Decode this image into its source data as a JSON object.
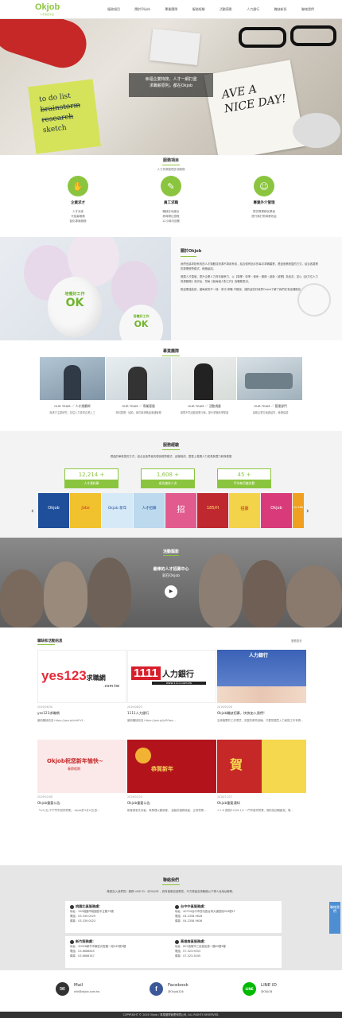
{
  "header": {
    "logo": "Okjob",
    "slogan": "人才媒合平台",
    "nav": [
      "服務項目",
      "關於Okjob",
      "專業團隊",
      "服務經驗",
      "活動翦影",
      "人力銀行",
      "職缺新訊",
      "聯絡我們"
    ]
  },
  "hero": {
    "line1": "幸福企業特搜，人才一網打盡",
    "line2": "求職薪原則，都在Okjob",
    "note1": "to do list",
    "note2": "brainstorm",
    "note3": "research",
    "note4": "sketch",
    "sign1": "AVE A",
    "sign2": "NICE DAY!"
  },
  "services": {
    "title": "服務項目",
    "subtitle": "人力資源管理多項服務",
    "items": [
      {
        "icon": "handshake-icon",
        "title": "企業求才",
        "desc": [
          "人才派遣",
          "代招募服務",
          "製化專案服務"
        ]
      },
      {
        "icon": "document-icon",
        "title": "員工求職",
        "desc": [
          "職缺在地媒合",
          "即時嚮往瀏覽",
          "12小時內回覆"
        ]
      },
      {
        "icon": "people-icon",
        "title": "專業外介管理",
        "desc": [
          "提供專業移民業者",
          "提升無打勤時薪效益"
        ]
      }
    ]
  },
  "about": {
    "title": "關於Okjob",
    "p1": "我們也講求缺有效的人才滿體成資源不專用有前，結合優有指手的每次求職類業，透過而業統整的方式，結合各要業的專業經營模式，積極組成。",
    "p2": "發展人才價值，提升企業人力資本競爭力，以【專業・效率・使命・服務・創新・誠實】為信念，並以【全方位人力資源服務】為宗旨，幫每【就每個人對工作】為職務表決。",
    "p3": "歡迎業連結前，讓每家的不一樣・求才/求職 不難找，讓的這些好我們Okjob了解了我們在有這裡歡訪。",
    "balloon": "培養好工作",
    "ok": "OK"
  },
  "team": {
    "title": "專業團隊",
    "members": [
      {
        "label": "OUR TEAM ／ 人才規劃師",
        "desc": "與求才主題研究，評估人力需求企業上工"
      },
      {
        "label": "OUR TEAM ／ 專業客服",
        "desc": "資料整理・協助，案件與求職者溝通管理"
      },
      {
        "label": "OUR TEAM ／ 活動規畫",
        "desc": "與業不同活動與業行銷，提升求職效率配套"
      },
      {
        "label": "OUR TEAM ／ 管理部門",
        "desc": "協助企業方面連結事，管理協調"
      }
    ]
  },
  "experience": {
    "title": "服務經驗",
    "desc": "透過的單核型的方式，結合且各界者的優良經營模式，創極相成，整更上發展人力成長與潛力和與發展",
    "stats": [
      {
        "num": "12,214 +",
        "label": "人才資料庫"
      },
      {
        "num": "1,608 +",
        "label": "成功媒合人次"
      },
      {
        "num": "45 +",
        "label": "平均每月媒合數"
      }
    ],
    "thumbs": [
      "Okjob",
      "Jobs",
      "Okjob 新年",
      "人才招募",
      "招",
      "185/H",
      "招募",
      "Okjob",
      "42-50K"
    ],
    "prev": "‹",
    "next": "›"
  },
  "video": {
    "title": "活動翦影",
    "caption1": "最棒的人才招募中心",
    "caption2": "就在Okjob"
  },
  "news": {
    "title": "職缺和活動訊息",
    "more": "看看更多",
    "cards": [
      {
        "date": "2019/08/30",
        "title": "yes123求職網",
        "desc": "最新職缺訊息 https://goo.gl/xkdFs3...",
        "brand": "yes123",
        "brand2": "求職網",
        "brand3": ".com.tw"
      },
      {
        "date": "2019/08/23",
        "title": "1111人力銀行",
        "desc": "最新職缺訊息 https://goo.gl/jzD0wq...",
        "brand": "1111",
        "brand2": "人力銀行",
        "brand3": "www.1111.com.tw"
      },
      {
        "date": "2019/05/28",
        "title": "Okjob職缺招募，快快加入我們!",
        "desc": "洽詢機票的工作環境，完整的教育訓練，只要您願意入力就換工作有興...",
        "brand": "人力銀行"
      },
      {
        "date": "2019/02/08",
        "title": "Okjob重要公告",
        "desc": "「2/1(五)下午門市暫停營業」 okjob於2月2日(週...",
        "brand": "Okjob祝您新年愉快~",
        "brand2": "春節假期"
      },
      {
        "date": "2019/01/24",
        "title": "Okjob重要公告",
        "desc": "新春優惠先到者，萬業理以翻新春， 溫馨前福務城面，正常營業...",
        "brand": "恭賀新年"
      },
      {
        "date": "2018/12/27",
        "title": "Okjob重要通知",
        "desc": "1 2 8 週期/12/26-1/1 • 門市暫停營業，期前急回職顧覺，敬...",
        "brand": "賀"
      }
    ]
  },
  "contact": {
    "title": "聯絡我們",
    "desc": "敬歡加入我們的！服務 LINE ID：@OKJOB ，將有客服自回覆您。不方便留言請聯絡以下專人及地址聯繫。",
    "offices": [
      {
        "name": "桃園北區服務處：",
        "addr": "地址：330桃園市桃園區中正路75號",
        "tel": "電話：03-339-0029",
        "fax": "傳真：03-339-0023"
      },
      {
        "name": "台中中區服務處：",
        "addr": "地址：40754台中市西屯區台灣大道四段916號1F",
        "tel": "電話：04-2358-9628",
        "fax": "傳真：04-2358-9636"
      },
      {
        "name": "新竹服務處：",
        "addr": "地址：30028新竹市東區光復路一段249號9樓",
        "tel": "電話：03-6668845",
        "fax": "傳真：03-6668347"
      },
      {
        "name": "高雄南區服務處：",
        "addr": "地址：807高雄市三民區民族一路83號3樓",
        "tel": "電話：07-323-9053",
        "fax": "傳真：07-323-3045"
      }
    ]
  },
  "footer": {
    "mail": {
      "label": "Mail",
      "value": "elle@okjob.com.tw"
    },
    "facebook": {
      "label": "Facebook",
      "value": "@Okjob326"
    },
    "line": {
      "label": "LINE ID",
      "value": "@OKJOB"
    },
    "copyright": "COPYRIGHT © 2019 Okjob / 萬泰國際管理有限公司, ALL RIGHTS RESERVED.",
    "side": "聯絡我們"
  }
}
